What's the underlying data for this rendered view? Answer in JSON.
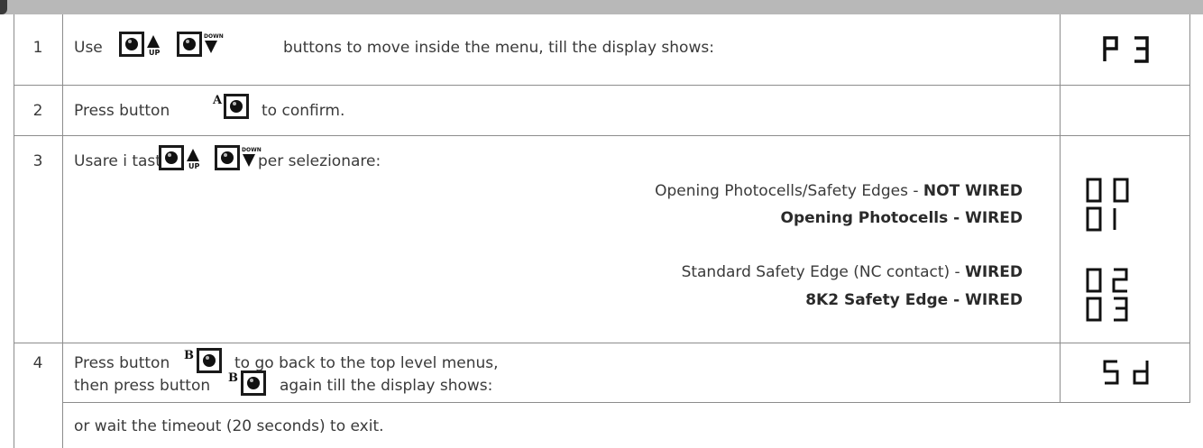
{
  "rows": [
    {
      "num": "1",
      "text_before": "Use",
      "text_after": "buttons to move inside the menu, till the display shows:",
      "display": "P 3"
    },
    {
      "num": "2",
      "text_before": "Press button",
      "text_after": "to confirm.",
      "display": ""
    },
    {
      "num": "3",
      "text_before": "Usare i tasti",
      "text_after": "per selezionare:",
      "options": [
        {
          "normal": "Opening Photocells/Safety Edges - ",
          "bold": "NOT WIRED",
          "display": "0 0"
        },
        {
          "normal": "",
          "bold": "Opening Photocells - WIRED",
          "display": "0 1"
        },
        {
          "normal": "Standard Safety Edge (NC contact) - ",
          "bold": "WIRED",
          "display": "0 2"
        },
        {
          "normal": "",
          "bold": "8K2 Safety Edge - WIRED",
          "display": "0 3"
        }
      ]
    },
    {
      "num": "4",
      "line1_before": "Press button",
      "line1_after": "to go back to the top level menus,",
      "line2_before": "then press button",
      "line2_after": "again till the display shows:",
      "display": "S d",
      "footer": "or wait the timeout (20 seconds) to exit."
    }
  ],
  "button_labels": {
    "up": "UP",
    "down": "DOWN",
    "a": "A",
    "b": "B"
  }
}
